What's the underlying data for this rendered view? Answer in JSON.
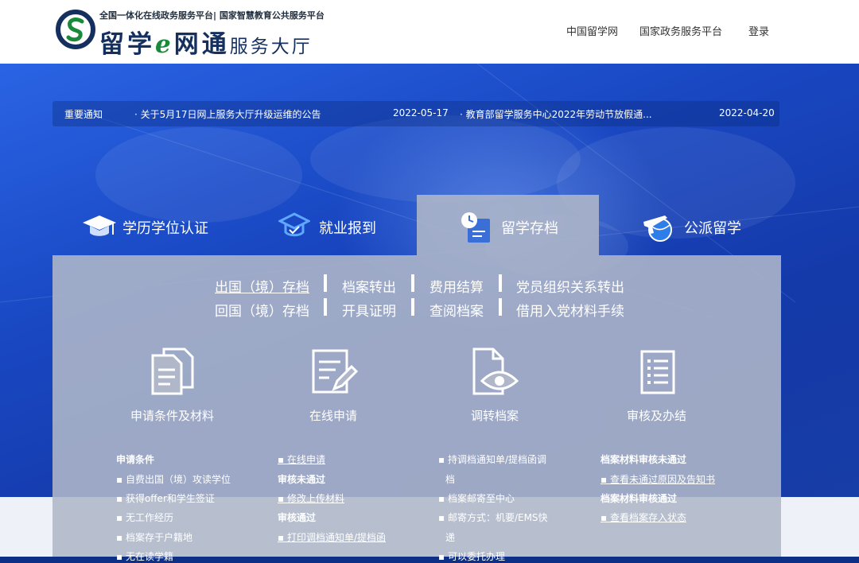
{
  "header": {
    "tagline": "全国一体化在线政务服务平台| 国家智慧教育公共服务平台",
    "brand_a": "留学",
    "brand_e": "e",
    "brand_b": "网通",
    "brand_service": "服务大厅",
    "nav": [
      "中国留学网",
      "国家政务服务平台",
      "登录"
    ]
  },
  "notice": {
    "label": "重要通知",
    "items": [
      {
        "text": "· 关于5月17日网上服务大厅升级运维的公告",
        "date": "2022-05-17"
      },
      {
        "text": "· 教育部留学服务中心2022年劳动节放假通...",
        "date": "2022-04-20"
      }
    ]
  },
  "tabs": [
    {
      "label": "学历学位认证",
      "icon": "graduation-cap-icon"
    },
    {
      "label": "就业报到",
      "icon": "mortarboard-icon"
    },
    {
      "label": "留学存档",
      "icon": "archive-file-icon"
    },
    {
      "label": "公派留学",
      "icon": "airplane-globe-icon"
    }
  ],
  "sublinks": {
    "row1": [
      "出国（境）存档",
      "档案转出",
      "费用结算",
      "党员组织关系转出"
    ],
    "row2": [
      "回国（境）存档",
      "开具证明",
      "查阅档案",
      "借用入党材料手续"
    ]
  },
  "steps": [
    {
      "label": "申请条件及材料",
      "icon": "documents-icon"
    },
    {
      "label": "在线申请",
      "icon": "edit-form-icon"
    },
    {
      "label": "调转档案",
      "icon": "file-eye-icon"
    },
    {
      "label": "审核及办结",
      "icon": "checklist-icon"
    }
  ],
  "col1": [
    "申请条件",
    "▪ 自费出国（境）攻读学位",
    "▪ 获得offer和学生签证",
    "▪ 无工作经历",
    "▪ 档案存于户籍地",
    "▪ 无在读学籍"
  ],
  "col2": [
    "▪ 在线申请",
    "审核未通过",
    "▪ 修改上传材料",
    "审核通过",
    "▪ 打印调档通知单/提档函"
  ],
  "col3": [
    "▪ 持调档通知单/提档函调",
    "档",
    "▪ 档案邮寄至中心",
    "▪ 邮寄方式：机要/EMS快",
    "递",
    "▪ 可以委托办理"
  ],
  "col4": [
    "档案材料审核未通过",
    "▪ 查看未通过原因及告知书",
    "档案材料审核通过",
    "▪ 查看档案存入状态"
  ],
  "colors": {
    "accent": "#1947c2",
    "panel": "#afb7c8",
    "brand": "#15305e",
    "green": "#1a8a3a"
  }
}
